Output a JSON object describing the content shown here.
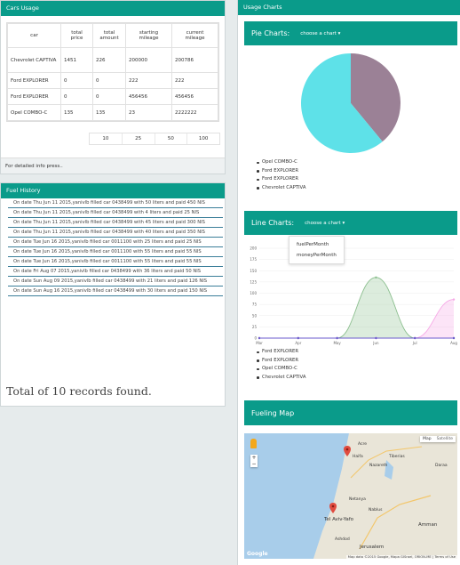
{
  "cars_usage": {
    "title": "Cars Usage",
    "headers": [
      "car",
      "total\nprice",
      "total\namount",
      "starting\nmileage",
      "current\nmileage"
    ],
    "rows": [
      [
        "Chevrolet CAPTIVA",
        "1451",
        "226",
        "200000",
        "200786"
      ],
      [
        "Ford EXPLORER",
        "0",
        "0",
        "222",
        "222"
      ],
      [
        "Ford EXPLORER",
        "0",
        "0",
        "456456",
        "456456"
      ],
      [
        "Opel COMBO-C",
        "135",
        "135",
        "23",
        "2222222"
      ]
    ],
    "pager": [
      "10",
      "25",
      "50",
      "100"
    ],
    "footnote": "For detailed info press.."
  },
  "fuel_history": {
    "title": "Fuel History",
    "entries": [
      "On date Thu Jun 11 2015,yanivlb filled car 0438499 with 50 liters and paid 450 NIS",
      "On date Thu Jun 11 2015,yanivlb filled car 0438499 with 4 liters and paid 25 NIS",
      "On date Thu Jun 11 2015,yanivlb filled car 0438499 with 45 liters and paid 300 NIS",
      "On date Thu Jun 11 2015,yanivlb filled car 0438499 with 40 liters and paid 350 NIS",
      "On date Tue Jun 16 2015,yanivlb filled car 0011100 with 25 liters and paid 25 NIS",
      "On date Tue Jun 16 2015,yanivlb filled car 0011100 with 55 liters and paid 55 NIS",
      "On date Tue Jun 16 2015,yanivlb filled car 0011100 with 55 liters and paid 55 NIS",
      "On date Fri Aug 07 2015,yanivlb filled car 0438499 with 36 liters and paid 50 NIS",
      "On date Sun Aug 09 2015,yanivlb filled car 0438499 with 21 liters and paid 126 NIS",
      "On date Sun Aug 16 2015,yanivlb filled car 0438499 with 30 liters and paid 150 NIS"
    ],
    "total_text": "Total of 10 records found."
  },
  "usage_charts": {
    "title": "Usage Charts",
    "pie": {
      "label": "Pie Charts:",
      "dropdown": "choose a chart",
      "legend": [
        "Opel COMBO-C",
        "Ford EXPLORER",
        "Ford EXPLORER",
        "Chevrolet CAPTIVA"
      ]
    },
    "line": {
      "label": "Line Charts:",
      "dropdown": "choose a chart",
      "menu_options": [
        "fuelPerMonth",
        "moneyPerMonth"
      ],
      "legend": [
        "Ford EXPLORER",
        "Ford EXPLORER",
        "Opel COMBO-C",
        "Chevrolet CAPTIVA"
      ]
    },
    "map": {
      "label": "Fueling Map",
      "map_btn": "Map",
      "satellite_btn": "Satellite",
      "zoom_in": "+",
      "zoom_out": "−",
      "attribution": "Map data ©2015 Google, Mapa GISrael, ORION-ME | Terms of Use",
      "google": "Google",
      "places": [
        "Acre",
        "Haifa",
        "Tiberias",
        "Nazareth",
        "Daraa",
        "Netanya",
        "Tel Aviv-Yafo",
        "Jerusalem",
        "Amman",
        "Ashdod",
        "Nablus"
      ]
    }
  },
  "colors": {
    "accent": "#0a9b8a",
    "pie_cyan": "#5ee1e8",
    "pie_mauve": "#9b8196",
    "line_green": "#8cbf8f",
    "line_pink": "#f6a7e6"
  },
  "chart_data": [
    {
      "type": "pie",
      "title": "",
      "labels": [
        "",
        ""
      ],
      "values": [
        39,
        61
      ],
      "colors": [
        "#9b8196",
        "#5ee1e8"
      ]
    },
    {
      "type": "area",
      "title": "",
      "x": [
        "Mar",
        "Apr",
        "May",
        "Jun",
        "Jul",
        "Aug"
      ],
      "ylim": [
        0,
        200
      ],
      "yticks": [
        0,
        25,
        50,
        75,
        100,
        125,
        150,
        175,
        200
      ],
      "series": [
        {
          "color": "#8cbf8f",
          "values": [
            0,
            0,
            0,
            135,
            0,
            0
          ]
        },
        {
          "color": "#f6a7e6",
          "values": [
            0,
            0,
            0,
            0,
            0,
            86
          ]
        },
        {
          "color": "#6a5acd",
          "values": [
            0,
            0,
            0,
            0,
            0,
            0
          ]
        }
      ],
      "grid": true
    }
  ]
}
